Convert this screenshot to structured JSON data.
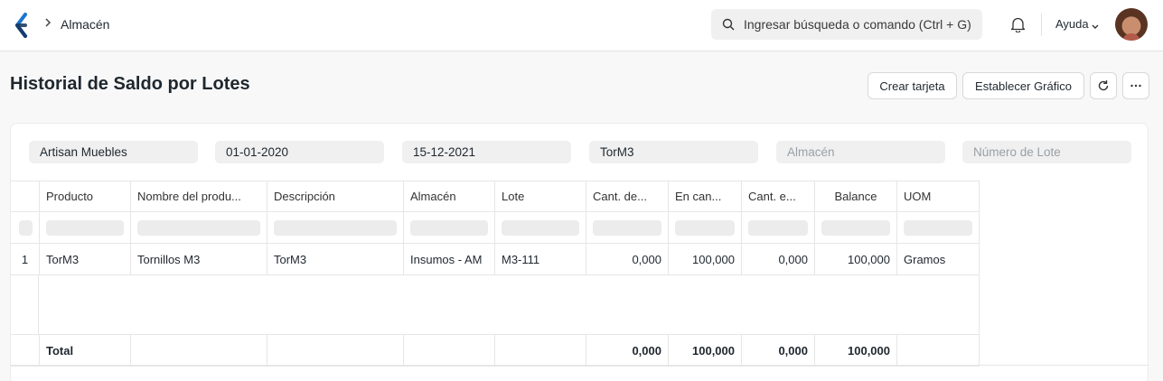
{
  "navbar": {
    "breadcrumb": "Almacén",
    "search_placeholder": "Ingresar búsqueda o comando (Ctrl + G)",
    "help_label": "Ayuda"
  },
  "page": {
    "title": "Historial de Saldo por Lotes",
    "buttons": {
      "create_card": "Crear tarjeta",
      "set_chart": "Establecer Gráfico"
    }
  },
  "filters": {
    "company": "Artisan Muebles",
    "from_date": "01-01-2020",
    "to_date": "15-12-2021",
    "item": "TorM3",
    "warehouse_placeholder": "Almacén",
    "batch_placeholder": "Número de Lote"
  },
  "table": {
    "columns": [
      "Producto",
      "Nombre del produ...",
      "Descripción",
      "Almacén",
      "Lote",
      "Cant. de...",
      "En can...",
      "Cant. e...",
      "Balance",
      "UOM"
    ],
    "rows": [
      {
        "index": "1",
        "cells": [
          "TorM3",
          "Tornillos M3",
          "TorM3",
          "Insumos - AM",
          "M3-111",
          "0,000",
          "100,000",
          "0,000",
          "100,000",
          "Gramos"
        ]
      }
    ],
    "total": {
      "label": "Total",
      "cells": [
        "",
        "",
        "",
        "",
        "0,000",
        "100,000",
        "0,000",
        "100,000",
        ""
      ]
    }
  },
  "colors": {
    "text": "#1f272e",
    "accent": "#1b75d0",
    "placeholder_bg": "#ececec"
  }
}
